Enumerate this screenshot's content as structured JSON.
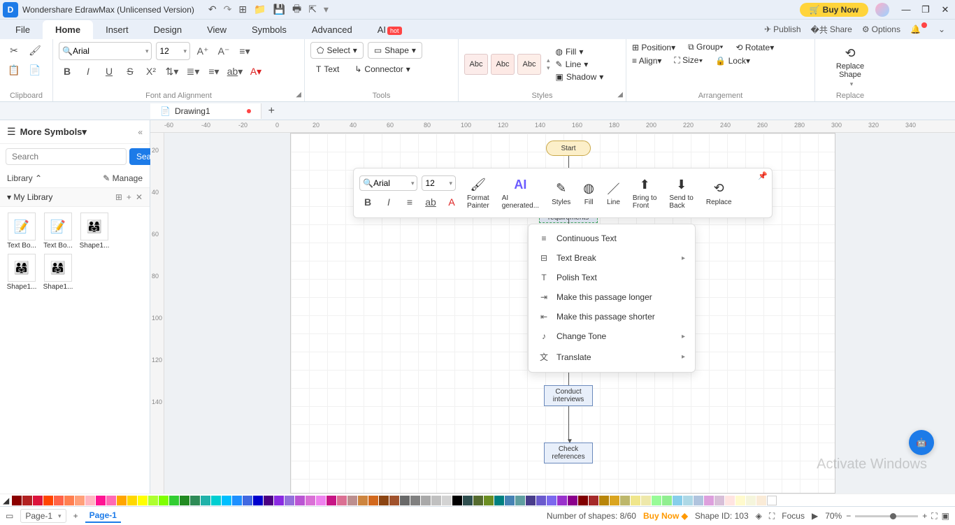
{
  "title": "Wondershare EdrawMax (Unlicensed Version)",
  "buynow": "Buy Now",
  "menus": {
    "file": "File",
    "home": "Home",
    "insert": "Insert",
    "design": "Design",
    "view": "View",
    "symbols": "Symbols",
    "advanced": "Advanced",
    "ai": "AI",
    "hot": "hot"
  },
  "topright": {
    "publish": "Publish",
    "share": "Share",
    "options": "Options"
  },
  "ribbon": {
    "clipboard": "Clipboard",
    "font_align": "Font and Alignment",
    "tools": "Tools",
    "styles": "Styles",
    "arrangement": "Arrangement",
    "replace": "Replace",
    "font": "Arial",
    "size": "12",
    "select": "Select",
    "shape": "Shape",
    "text": "Text",
    "connector": "Connector",
    "abc": "Abc",
    "fill": "Fill",
    "line": "Line",
    "shadow": "Shadow",
    "position": "Position",
    "align": "Align",
    "group": "Group",
    "size_btn": "Size",
    "rotate": "Rotate",
    "lock": "Lock",
    "replace_shape": "Replace\nShape"
  },
  "doc": {
    "name": "Drawing1"
  },
  "sidebar": {
    "more": "More Symbols",
    "search_ph": "Search",
    "search_btn": "Search",
    "library": "Library",
    "manage": "Manage",
    "mylib": "My Library",
    "items": [
      "Text Bo...",
      "Text Bo...",
      "Shape1...",
      "Shape1...",
      "Shape1..."
    ]
  },
  "flow": {
    "start": "Start",
    "requirements": "requirements",
    "conduct": "Conduct\ninterviews",
    "check": "Check\nreferences"
  },
  "minitb": {
    "font": "Arial",
    "size": "12",
    "format": "Format\nPainter",
    "ai": "AI\ngenerated...",
    "styles": "Styles",
    "fill": "Fill",
    "line": "Line",
    "btf": "Bring to\nFront",
    "stb": "Send to\nBack",
    "replace": "Replace"
  },
  "ctx": {
    "cont": "Continuous Text",
    "tb": "Text Break",
    "polish": "Polish Text",
    "longer": "Make this passage longer",
    "shorter": "Make this passage shorter",
    "tone": "Change Tone",
    "translate": "Translate"
  },
  "watermark": "Activate Windows",
  "status": {
    "page": "Page-1",
    "ptab": "Page-1",
    "shapes": "Number of shapes: 8/60",
    "buynow": "Buy Now",
    "shapeid": "Shape ID: 103",
    "focus": "Focus",
    "zoom": "70%"
  },
  "ruler_h": [
    "-60",
    "-20",
    "20",
    "60",
    "100",
    "140",
    "180",
    "220",
    "260",
    "300",
    "340"
  ],
  "ruler_h2": [
    "-40",
    "0",
    "40",
    "80",
    "120",
    "160",
    "200",
    "240",
    "280",
    "320"
  ],
  "ruler_v": [
    "20",
    "40",
    "60",
    "80",
    "100",
    "120",
    "140"
  ],
  "colors": [
    "#8b0000",
    "#d22",
    "#e55",
    "#e77",
    "#e99",
    "#f3a",
    "#f5b",
    "#f7c",
    "#fa6",
    "#fc8",
    "#fd9",
    "#fea",
    "#ca3",
    "#9a3",
    "#6a3",
    "#3a3",
    "#3a6",
    "#3a9",
    "#3ac",
    "#39c",
    "#36c",
    "#33c",
    "#63c",
    "#93c",
    "#c3c",
    "#c39",
    "#a33",
    "#833",
    "#633",
    "#433",
    "#222",
    "#555",
    "#888",
    "#aaa",
    "#ccc",
    "#eee"
  ]
}
